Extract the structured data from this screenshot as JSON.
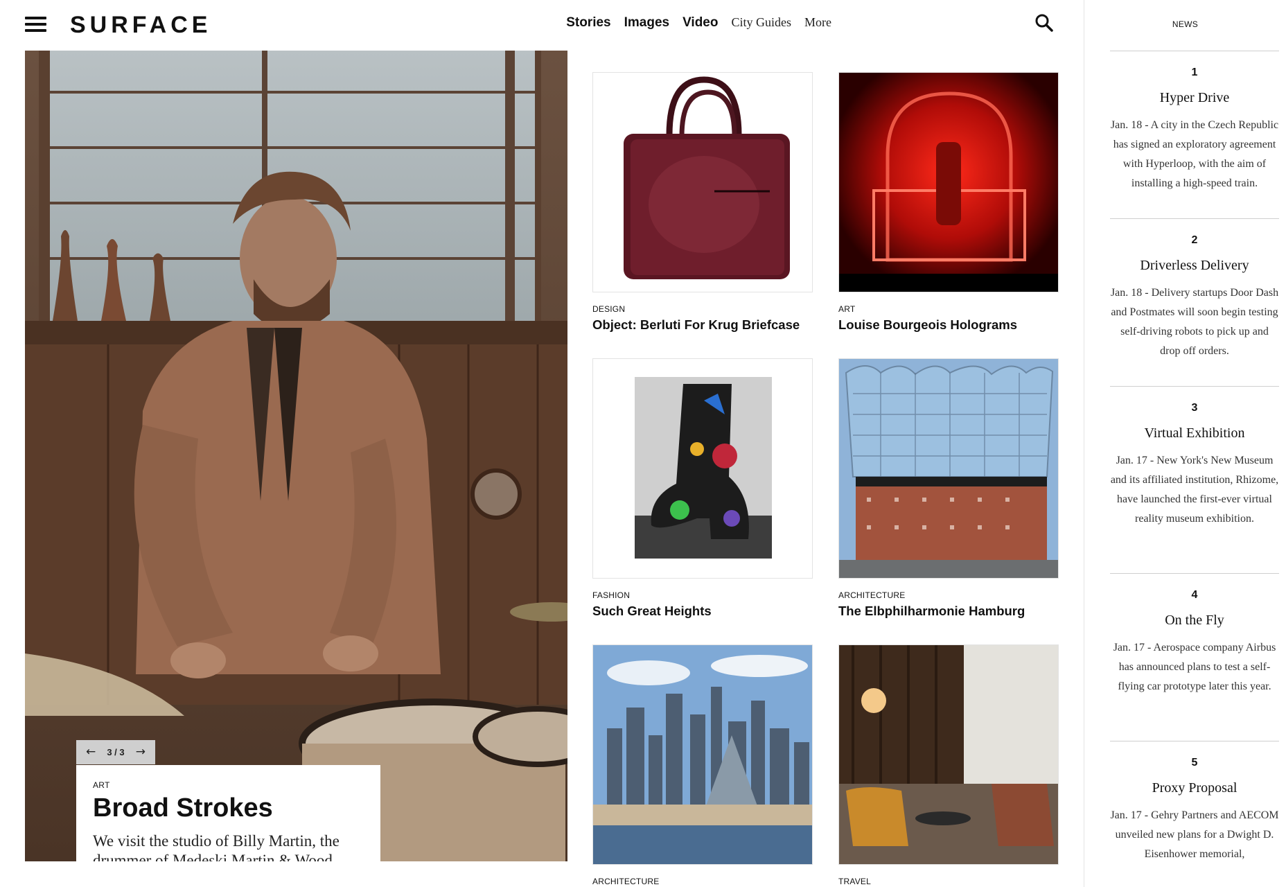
{
  "header": {
    "logo": "SURFACE",
    "nav": [
      {
        "label": "Stories"
      },
      {
        "label": "Images"
      },
      {
        "label": "Video"
      },
      {
        "label": "City Guides"
      },
      {
        "label": "More"
      }
    ]
  },
  "hero": {
    "slide": "3 / 3",
    "category": "ART",
    "title": "Broad Strokes",
    "description": "We visit the studio of Billy Martin, the drummer of Medeski Martin & Wood."
  },
  "stories": [
    {
      "category": "DESIGN",
      "title": "Object: Berluti For Krug Briefcase"
    },
    {
      "category": "ART",
      "title": "Louise Bourgeois Holograms"
    },
    {
      "category": "FASHION",
      "title": "Such Great Heights"
    },
    {
      "category": "ARCHITECTURE",
      "title": "The Elbphilharmonie Hamburg"
    },
    {
      "category": "ARCHITECTURE",
      "title": ""
    },
    {
      "category": "TRAVEL",
      "title": ""
    }
  ],
  "sidebar": {
    "heading": "NEWS",
    "items": [
      {
        "number": "1",
        "title": "Hyper Drive",
        "blurb": "Jan. 18 - A city in the Czech Republic has signed an exploratory agreement with Hyperloop, with the aim of installing a high-speed train."
      },
      {
        "number": "2",
        "title": "Driverless Delivery",
        "blurb": "Jan. 18 - Delivery startups Door Dash and Postmates will soon begin testing self-driving robots to pick up and drop off orders."
      },
      {
        "number": "3",
        "title": "Virtual Exhibition",
        "blurb": "Jan. 17 - New York's New Museum and its affiliated institution, Rhizome, have launched the first-ever virtual reality museum exhibition."
      },
      {
        "number": "4",
        "title": "On the Fly",
        "blurb": "Jan. 17 - Aerospace company Airbus has announced plans to test a self-flying car prototype later this year."
      },
      {
        "number": "5",
        "title": "Proxy Proposal",
        "blurb": "Jan. 17 - Gehry Partners and AECOM unveiled new plans for a Dwight D. Eisenhower memorial,"
      }
    ]
  },
  "colors": {
    "text": "#111111",
    "slider_bg": "#cfcfcf",
    "divider": "#cfcfcf"
  },
  "icons": [
    "menu-icon",
    "search-icon",
    "arrow-left-icon",
    "arrow-right-icon"
  ]
}
